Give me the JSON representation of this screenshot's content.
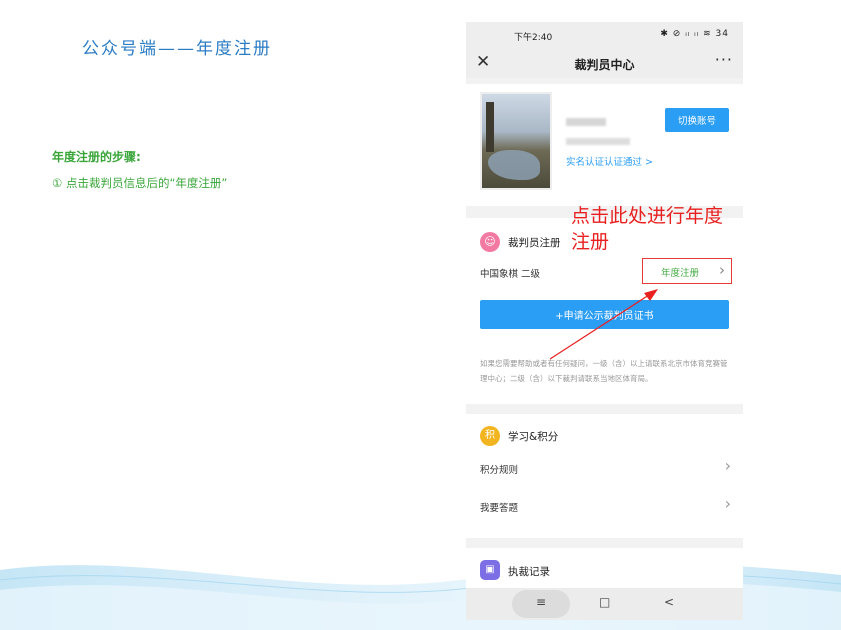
{
  "slide": {
    "title": "公众号端——年度注册",
    "steps_title": "年度注册的步骤:",
    "step_1": "① 点击裁判员信息后的“年度注册”"
  },
  "phone": {
    "status": {
      "time": "下午2:40",
      "icons": "✱ ⊘ ᵢₗ ᵢₗ ≋ 34"
    },
    "nav": {
      "close": "✕",
      "title": "裁判员中心",
      "more": "···"
    },
    "profile": {
      "verify_text": "实名认证认证通过 >",
      "switch_account": "切换账号"
    },
    "register": {
      "title": "裁判员注册",
      "level": "中国象棋 二级",
      "annual_register": "年度注册",
      "apply_button": "+申请公示裁判员证书",
      "help_text": "如果您需要帮助或者有任何疑问，一级（含）以上请联系北京市体育竞赛管理中心；二级（含）以下裁判请联系当地区体育局。"
    },
    "study": {
      "title": "学习&积分",
      "icon_char": "积",
      "rows": [
        {
          "label": "积分规则"
        },
        {
          "label": "我要答题"
        }
      ]
    },
    "record": {
      "title": "执裁记录"
    },
    "bottom": {
      "menu": "≡",
      "home": "□",
      "back": "<"
    }
  },
  "annotation": {
    "text": "点击此处进行年度注册"
  },
  "colors": {
    "accent": "#2a9df4",
    "annotation": "#e82020",
    "title": "#2b7cc4",
    "steps": "#3aa63a"
  }
}
